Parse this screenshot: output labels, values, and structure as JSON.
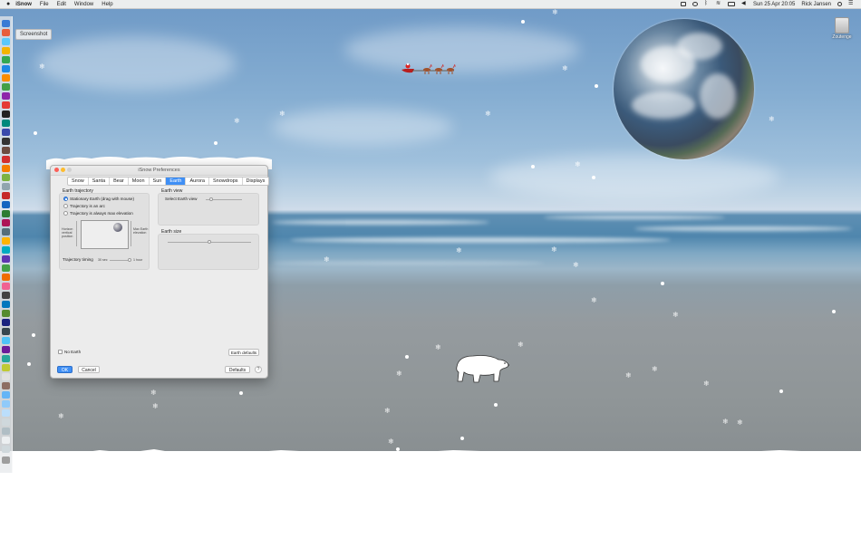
{
  "menubar": {
    "apple": "",
    "app_name": "iSnow",
    "menus": [
      "File",
      "Edit",
      "Window",
      "Help"
    ],
    "clock": "Sun 25 Apr  20:05",
    "user": "Rick Jansen"
  },
  "screenshot_label": "Screenshot",
  "desktop_icon": {
    "label": "Zoutenge",
    "icon": "drive-icon"
  },
  "window": {
    "title": "iSnow Preferences",
    "tabs": [
      {
        "label": "Snow",
        "active": false
      },
      {
        "label": "Santa",
        "active": false
      },
      {
        "label": "Bear",
        "active": false
      },
      {
        "label": "Moon",
        "active": false
      },
      {
        "label": "Sun",
        "active": false
      },
      {
        "label": "Earth",
        "active": true
      },
      {
        "label": "Aurora",
        "active": false
      },
      {
        "label": "Snowdrops",
        "active": false
      },
      {
        "label": "Displays",
        "active": false
      }
    ],
    "trajectory": {
      "heading": "Earth trajectory",
      "options": [
        {
          "label": "Stationary Earth (drag with mouse)",
          "selected": true
        },
        {
          "label": "Trajectory is an arc",
          "selected": false
        },
        {
          "label": "Trajectory is always max elevation",
          "selected": false
        }
      ],
      "left_label_1": "Horizon",
      "left_label_2": "vertical",
      "left_label_3": "position",
      "right_label_1": "Max Earth",
      "right_label_2": "elevation",
      "timing_label": "Trajectory timing",
      "timing_min": "30 sec",
      "timing_max": "1 hour",
      "timing_value": 0.9
    },
    "earth_view": {
      "heading": "Earth view",
      "label": "Select Earth view",
      "value": 0.15
    },
    "earth_size": {
      "heading": "Earth size",
      "value": 0.5
    },
    "no_earth_label": "No Earth",
    "earth_defaults_label": "Earth defaults",
    "ok_label": "OK",
    "cancel_label": "Cancel",
    "defaults_label": "Defaults",
    "help_label": "?"
  }
}
